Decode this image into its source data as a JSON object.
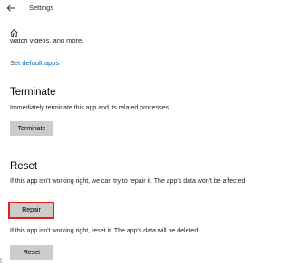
{
  "window": {
    "title": "Settings"
  },
  "top_partial": {
    "clipped_text": "watch videos, and more.",
    "link": "Set default apps"
  },
  "terminate": {
    "heading": "Terminate",
    "description": "Immediately terminate this app and its related processes.",
    "button_label": "Terminate"
  },
  "reset": {
    "heading": "Reset",
    "repair_description": "If this app isn't working right, we can try to repair it. The app's data won't be affected.",
    "repair_button_label": "Repair",
    "reset_description": "If this app isn't working right, reset it. The app's data will be deleted.",
    "reset_button_label": "Reset"
  },
  "colors": {
    "link": "#0063b1",
    "button_bg": "#cccccc",
    "highlight_border": "#e02020"
  }
}
